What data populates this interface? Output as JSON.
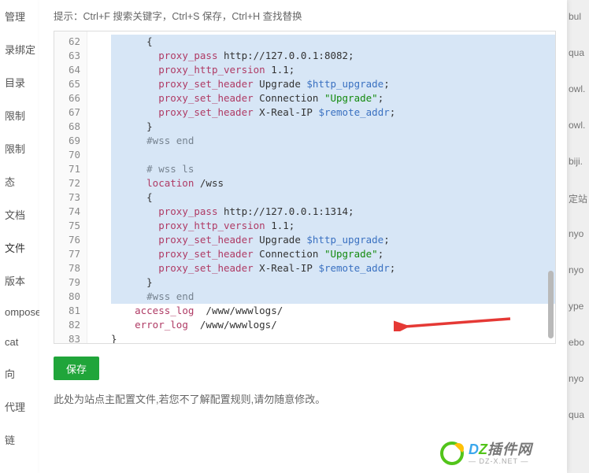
{
  "hint": "提示：Ctrl+F 搜索关键字，Ctrl+S 保存，Ctrl+H 查找替换",
  "save_label": "保存",
  "footer_note": "此处为站点主配置文件,若您不了解配置规则,请勿随意修改。",
  "sidebar_left": {
    "items": [
      "管理",
      "录绑定",
      "目录",
      "限制",
      "限制",
      "态",
      "文档",
      "文件",
      "版本",
      "omposer",
      "cat",
      "向",
      "代理",
      "链"
    ],
    "active_index": 7
  },
  "editor": {
    "first_line": 62,
    "selection_end_line": 80,
    "lines": [
      {
        "n": 62,
        "indent": "      ",
        "html": "{"
      },
      {
        "n": 63,
        "indent": "        ",
        "html": "<span class='tok-dir'>proxy_pass</span> http://127.0.0.1:8082;"
      },
      {
        "n": 64,
        "indent": "        ",
        "html": "<span class='tok-dir'>proxy_http_version</span> 1.1;"
      },
      {
        "n": 65,
        "indent": "        ",
        "html": "<span class='tok-dir'>proxy_set_header</span> Upgrade <span class='tok-var'>$http_upgrade</span>;"
      },
      {
        "n": 66,
        "indent": "        ",
        "html": "<span class='tok-dir'>proxy_set_header</span> Connection <span class='tok-str'>\"Upgrade\"</span>;"
      },
      {
        "n": 67,
        "indent": "        ",
        "html": "<span class='tok-dir'>proxy_set_header</span> X-Real-IP <span class='tok-var'>$remote_addr</span>;"
      },
      {
        "n": 68,
        "indent": "      ",
        "html": "}"
      },
      {
        "n": 69,
        "indent": "      ",
        "html": "<span class='tok-cmt'>#wss end</span>"
      },
      {
        "n": 70,
        "indent": "",
        "html": ""
      },
      {
        "n": 71,
        "indent": "      ",
        "html": "<span class='tok-cmt'># wss ls</span>"
      },
      {
        "n": 72,
        "indent": "      ",
        "html": "<span class='tok-dir'>location</span> /wss"
      },
      {
        "n": 73,
        "indent": "      ",
        "html": "{"
      },
      {
        "n": 74,
        "indent": "        ",
        "html": "<span class='tok-dir'>proxy_pass</span> http://127.0.0.1:1314;"
      },
      {
        "n": 75,
        "indent": "        ",
        "html": "<span class='tok-dir'>proxy_http_version</span> 1.1;"
      },
      {
        "n": 76,
        "indent": "        ",
        "html": "<span class='tok-dir'>proxy_set_header</span> Upgrade <span class='tok-var'>$http_upgrade</span>;"
      },
      {
        "n": 77,
        "indent": "        ",
        "html": "<span class='tok-dir'>proxy_set_header</span> Connection <span class='tok-str'>\"Upgrade\"</span>;"
      },
      {
        "n": 78,
        "indent": "        ",
        "html": "<span class='tok-dir'>proxy_set_header</span> X-Real-IP <span class='tok-var'>$remote_addr</span>;"
      },
      {
        "n": 79,
        "indent": "      ",
        "html": "}"
      },
      {
        "n": 80,
        "indent": "      ",
        "html": "<span class='tok-cmt'>#wss end</span>"
      },
      {
        "n": 81,
        "indent": "    ",
        "html": "<span class='tok-dir'>access_log</span>  /www/wwwlogs/"
      },
      {
        "n": 82,
        "indent": "    ",
        "html": "<span class='tok-dir'>error_log</span>  /www/wwwlogs/"
      },
      {
        "n": 83,
        "indent": "",
        "html": "}"
      }
    ]
  },
  "right_strip": [
    "bul",
    "qua",
    "owl.",
    "owl.",
    "biji.",
    "定站",
    "nyo",
    "nyo",
    "ype",
    "ebo",
    "nyo",
    "qua"
  ],
  "watermark": {
    "brand_prefix": "D",
    "brand_mid": "Z",
    "brand_suffix": "插件网",
    "sub": "— DZ-X.NET —"
  }
}
